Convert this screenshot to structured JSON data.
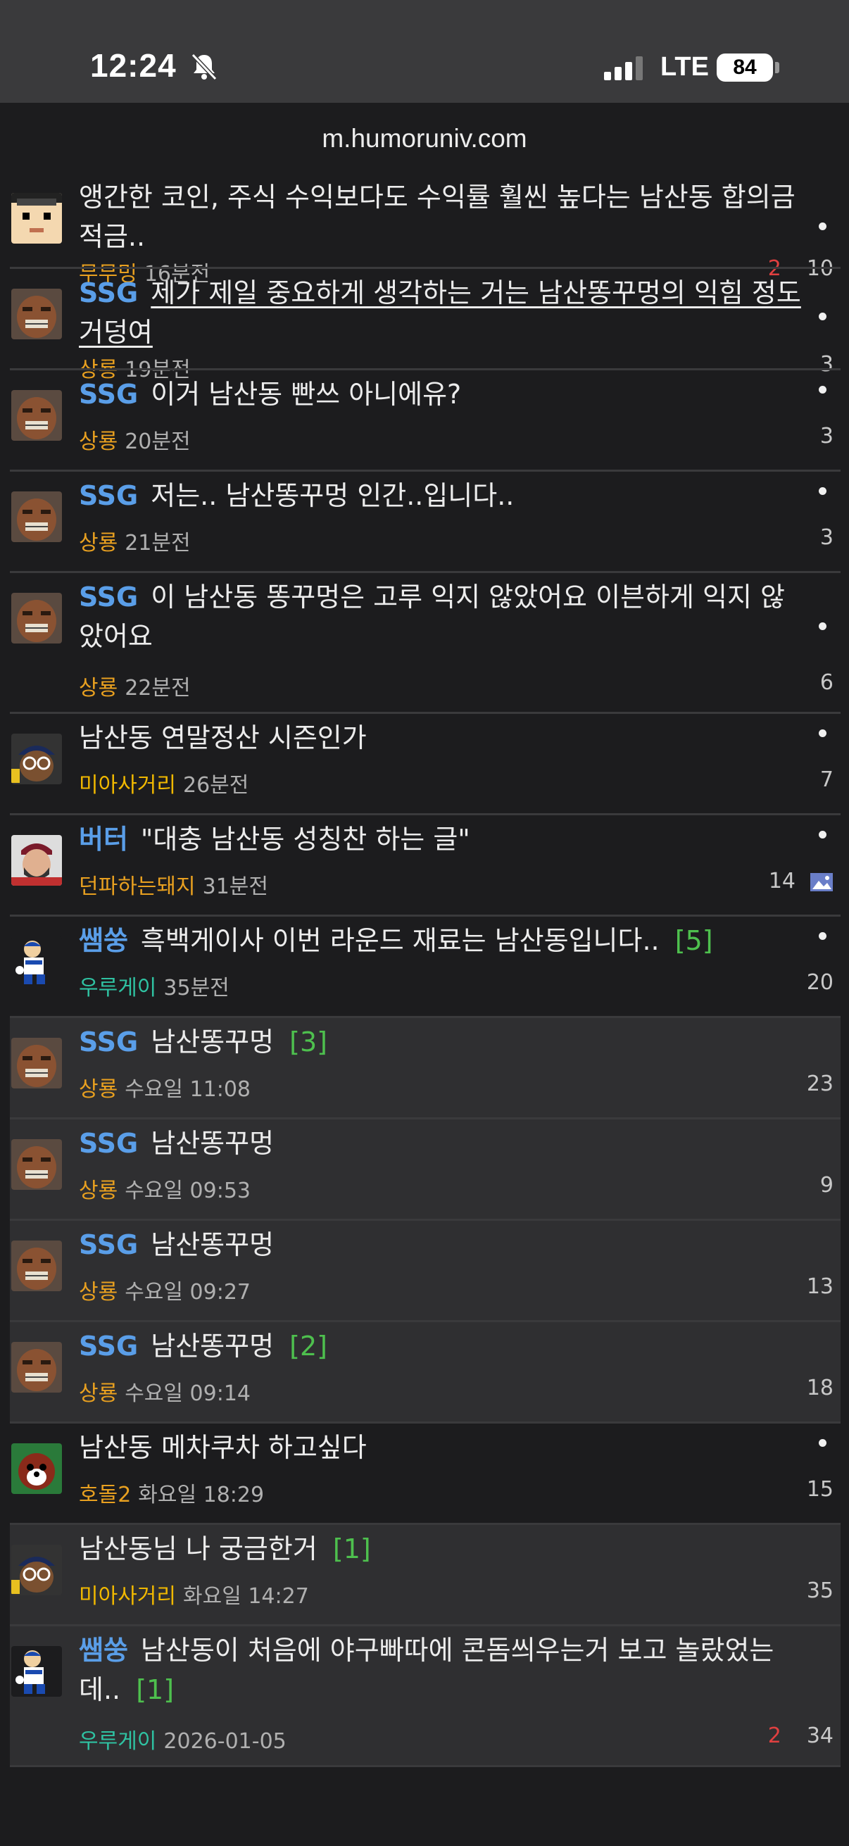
{
  "status": {
    "time": "12:24",
    "network": "LTE",
    "battery": "84"
  },
  "url": "m.humoruniv.com",
  "posts": [
    {
      "tag": "",
      "title": "앵간한 코인, 주식 수익보다도 수익률 훨씬 높다는 남산동 합의금 적금..",
      "comments": "",
      "user": "무무밍",
      "time": "16분전",
      "red": "2",
      "count": "10",
      "avatar": "pixel-face-avatar"
    },
    {
      "tag": "SSG",
      "title": "제가 제일 중요하게 생각하는 거는 남산똥꾸멍의 익힘 정도거덩여",
      "comments": "",
      "user": "상룡",
      "time": "19분전",
      "red": "",
      "count": "3",
      "avatar": "brown-face-avatar"
    },
    {
      "tag": "SSG",
      "title": "이거 남산동 빤쓰 아니에유?",
      "comments": "",
      "user": "상룡",
      "time": "20분전",
      "red": "",
      "count": "3",
      "avatar": "brown-face-avatar"
    },
    {
      "tag": "SSG",
      "title": "저는.. 남산똥꾸멍 인간..입니다..",
      "comments": "",
      "user": "상룡",
      "time": "21분전",
      "red": "",
      "count": "3",
      "avatar": "brown-face-avatar"
    },
    {
      "tag": "SSG",
      "title": "이 남산동 똥꾸멍은 고루 익지 않았어요 이븐하게 익지 않았어요",
      "comments": "",
      "user": "상룡",
      "time": "22분전",
      "red": "",
      "count": "6",
      "avatar": "brown-face-avatar"
    },
    {
      "tag": "",
      "title": "남산동 연말정산 시즌인가",
      "comments": "",
      "user": "미아사거리",
      "time": "26분전",
      "red": "",
      "count": "7",
      "avatar": "glasses-cap-avatar"
    },
    {
      "tag": "버터",
      "title": "\"대충 남산동 성칭찬 하는 글\"",
      "comments": "",
      "user": "던파하는돼지",
      "time": "31분전",
      "red": "",
      "count": "14",
      "avatar": "bearded-man-avatar"
    },
    {
      "tag": "쌤쑹",
      "title": "흑백게이사 이번 라운드 재료는 남산동입니다..",
      "comments": "[5]",
      "user": "우루게이",
      "time": "35분전",
      "red": "",
      "count": "20",
      "avatar": "baseball-player-avatar"
    },
    {
      "tag": "SSG",
      "title": "남산똥꾸멍",
      "comments": "[3]",
      "user": "상룡",
      "time": "수요일 11:08",
      "red": "",
      "count": "23",
      "avatar": "brown-face-avatar"
    },
    {
      "tag": "SSG",
      "title": "남산똥꾸멍",
      "comments": "",
      "user": "상룡",
      "time": "수요일 09:53",
      "red": "",
      "count": "9",
      "avatar": "brown-face-avatar"
    },
    {
      "tag": "SSG",
      "title": "남산똥꾸멍",
      "comments": "",
      "user": "상룡",
      "time": "수요일 09:27",
      "red": "",
      "count": "13",
      "avatar": "brown-face-avatar"
    },
    {
      "tag": "SSG",
      "title": "남산똥꾸멍",
      "comments": "[2]",
      "user": "상룡",
      "time": "수요일 09:14",
      "red": "",
      "count": "18",
      "avatar": "brown-face-avatar"
    },
    {
      "tag": "",
      "title": "남산동 메차쿠차 하고싶다",
      "comments": "",
      "user": "호돌2",
      "time": "화요일 18:29",
      "red": "",
      "count": "15",
      "avatar": "tiger-mascot-avatar"
    },
    {
      "tag": "",
      "title": "남산동님 나 궁금한거",
      "comments": "[1]",
      "user": "미아사거리",
      "time": "화요일 14:27",
      "red": "",
      "count": "35",
      "avatar": "glasses-cap-avatar"
    },
    {
      "tag": "쌤쑹",
      "title": "남산동이 처음에 야구빠따에 콘돔씌우는거 보고 놀랐었는데..",
      "comments": "[1]",
      "user": "우루게이",
      "time": "2026-01-05",
      "red": "2",
      "count": "34",
      "avatar": "baseball-player-avatar"
    }
  ]
}
